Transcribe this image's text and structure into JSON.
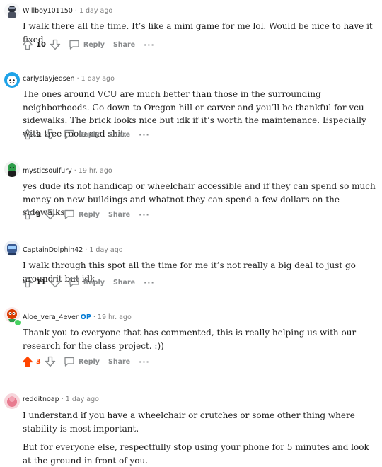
{
  "comments": [
    {
      "username": "Willboy101150",
      "separator": "·",
      "time": "1 day ago",
      "paragraphs": [
        "I walk there all the time. It’s like a mini game for me lol. Would be nice to have it fixed"
      ],
      "score": "10",
      "reply_label": "Reply",
      "share_label": "Share",
      "more_label": "···",
      "upvoted": false
    },
    {
      "username": "carlyslayjedsen",
      "separator": "·",
      "time": "1 day ago",
      "paragraphs": [
        "The ones around VCU are much better than those in the surrounding neighborhoods. Go down to Oregon hill or carver and you’ll be thankful for vcu sidewalks. The brick looks nice but idk if it’s worth the maintenance. Especially with tree roots and shit."
      ],
      "score": "9",
      "reply_label": "Reply",
      "share_label": "Share",
      "more_label": "···",
      "upvoted": false
    },
    {
      "username": "mysticsoulfury",
      "separator": "·",
      "time": "19 hr. ago",
      "paragraphs": [
        "yes dude its not handicap or wheelchair accessible and if they can spend so much money on new buildings and whatnot they can spend a few dollars on the sidewalks"
      ],
      "score": "3",
      "reply_label": "Reply",
      "share_label": "Share",
      "more_label": "···",
      "upvoted": false
    },
    {
      "username": "CaptainDolphin42",
      "separator": "·",
      "time": "1 day ago",
      "paragraphs": [
        "I walk through this spot all the time for me it’s not really a big deal to just go around it but idk"
      ],
      "score": "11",
      "reply_label": "Reply",
      "share_label": "Share",
      "more_label": "···",
      "upvoted": false
    },
    {
      "username": "Aloe_vera_4ever",
      "op_badge": "OP",
      "separator": "·",
      "time": "19 hr. ago",
      "paragraphs": [
        "Thank you to everyone that has commented, this is really helping us with our research for the class project. :))"
      ],
      "score": "3",
      "reply_label": "Reply",
      "share_label": "Share",
      "more_label": "···",
      "upvoted": true
    },
    {
      "username": "redditnoap",
      "separator": "·",
      "time": "1 day ago",
      "paragraphs": [
        "I understand if you have a wheelchair or crutches or some other thing where stability is most important.",
        "But for everyone else, respectfully stop using your phone for 5 minutes and look at the ground in front of you."
      ]
    }
  ],
  "colors": {
    "upvote_active": "#ff4500",
    "op_badge": "#0079d3",
    "muted": "#878a8c",
    "online": "#46d160"
  },
  "icons": [
    "upvote-arrow-icon",
    "downvote-arrow-icon",
    "reply-bubble-icon",
    "more-options-icon"
  ]
}
